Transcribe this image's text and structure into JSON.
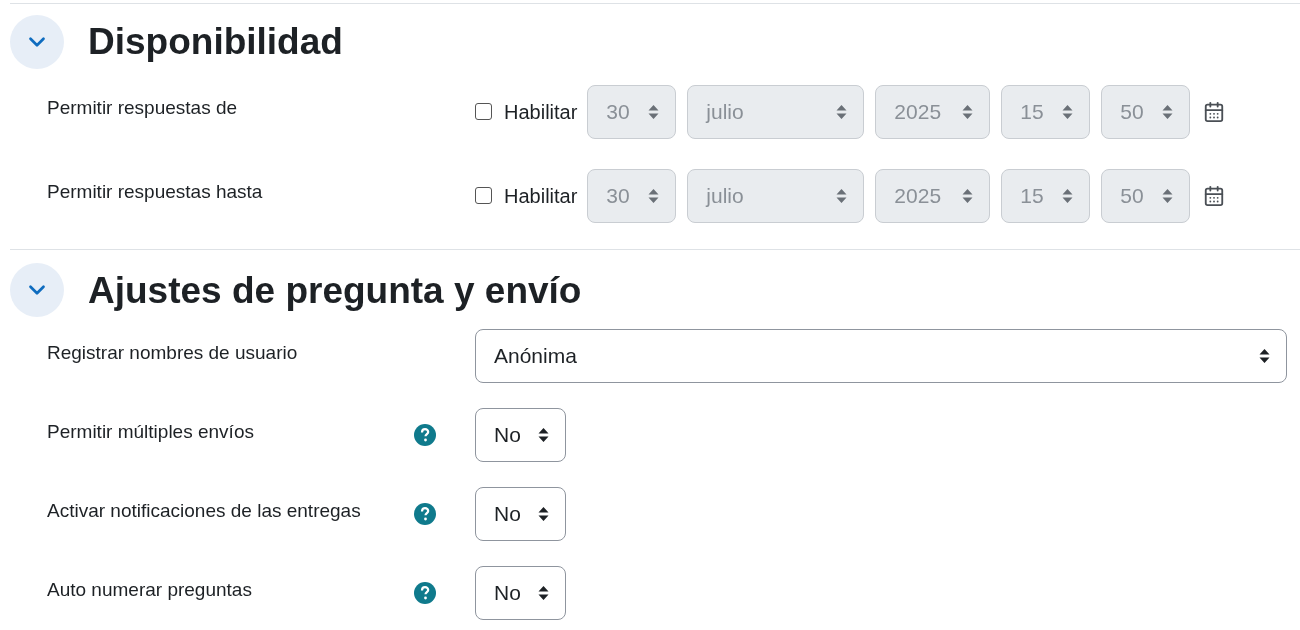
{
  "sections": [
    {
      "title": "Disponibilidad",
      "expanded": true,
      "fields": [
        {
          "kind": "date",
          "label": "Permitir respuestas de",
          "enable_label": "Habilitar",
          "checked": false,
          "parts": [
            "30",
            "julio",
            "2025",
            "15",
            "50"
          ]
        },
        {
          "kind": "date",
          "label": "Permitir respuestas hasta",
          "enable_label": "Habilitar",
          "checked": false,
          "parts": [
            "30",
            "julio",
            "2025",
            "15",
            "50"
          ]
        }
      ]
    },
    {
      "title": "Ajustes de pregunta y envío",
      "expanded": true,
      "fields": [
        {
          "kind": "wide_select",
          "label": "Registrar nombres de usuario",
          "value": "Anónima",
          "help": false
        },
        {
          "kind": "select",
          "label": "Permitir múltiples envíos",
          "value": "No",
          "help": true
        },
        {
          "kind": "select",
          "label": "Activar notificaciones de las entregas",
          "value": "No",
          "help": true
        },
        {
          "kind": "select",
          "label": "Auto numerar preguntas",
          "value": "No",
          "help": true
        }
      ]
    }
  ]
}
